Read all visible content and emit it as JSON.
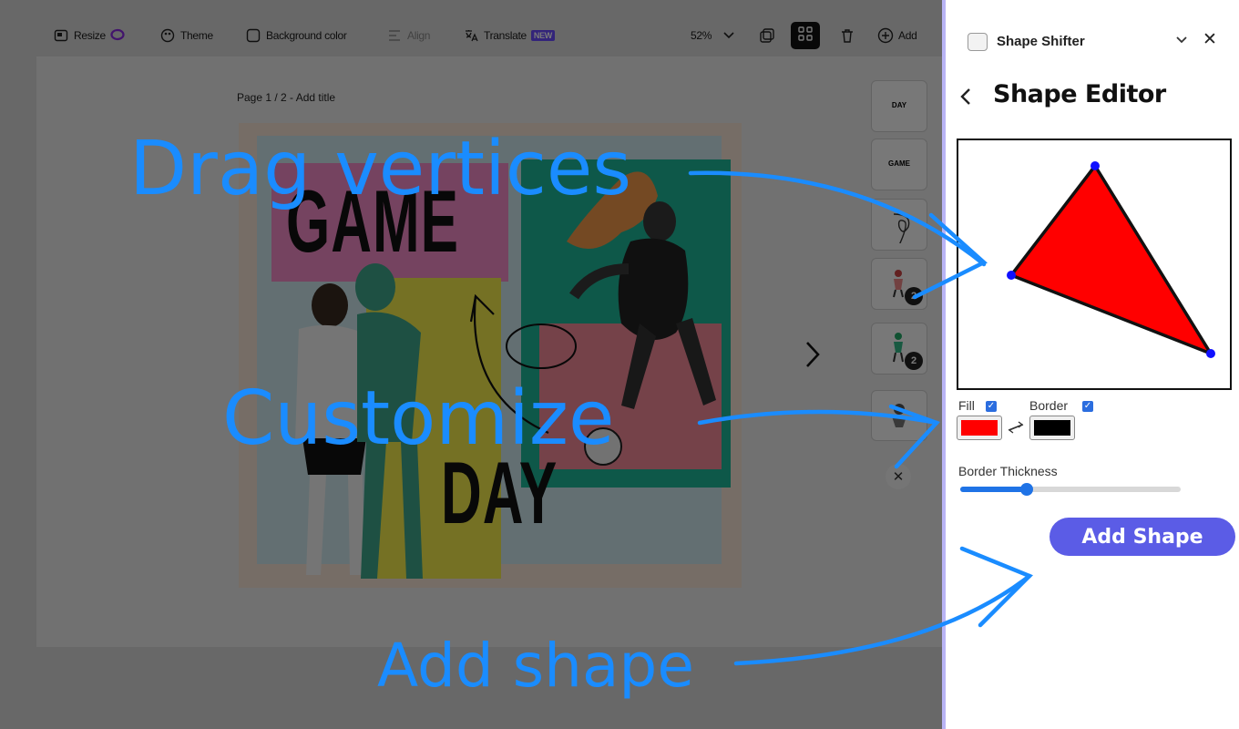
{
  "toolbar": {
    "resize": "Resize",
    "theme": "Theme",
    "background_color": "Background color",
    "align": "Align",
    "translate": "Translate",
    "translate_badge": "NEW",
    "zoom": "52%",
    "add": "Add"
  },
  "canvas": {
    "page_label": "Page 1 / 2 - Add title",
    "poster_line1": "GAME",
    "poster_line2": "DAY"
  },
  "thumbnails": {
    "items": [
      {
        "text": "DAY",
        "badge": ""
      },
      {
        "text": "GAME",
        "badge": ""
      },
      {
        "text": "",
        "badge": ""
      },
      {
        "text": "",
        "badge": "2"
      },
      {
        "text": "",
        "badge": "2"
      },
      {
        "text": "",
        "badge": ""
      }
    ]
  },
  "panel": {
    "app_name": "Shape Shifter",
    "title": "Shape Editor",
    "fill_label": "Fill",
    "border_label": "Border",
    "fill_color": "#ff0000",
    "border_color": "#000000",
    "fill_enabled": true,
    "border_enabled": true,
    "thickness_label": "Border Thickness",
    "thickness_value": 0.3,
    "add_button": "Add Shape"
  },
  "annotations": {
    "drag_vertices": "Drag vertices",
    "customize": "Customize",
    "add_shape": "Add shape",
    "color": "#1a8cff"
  },
  "colors": {
    "accent": "#5b5ce6",
    "slider": "#1f73e6",
    "vertex": "#1010ff"
  }
}
